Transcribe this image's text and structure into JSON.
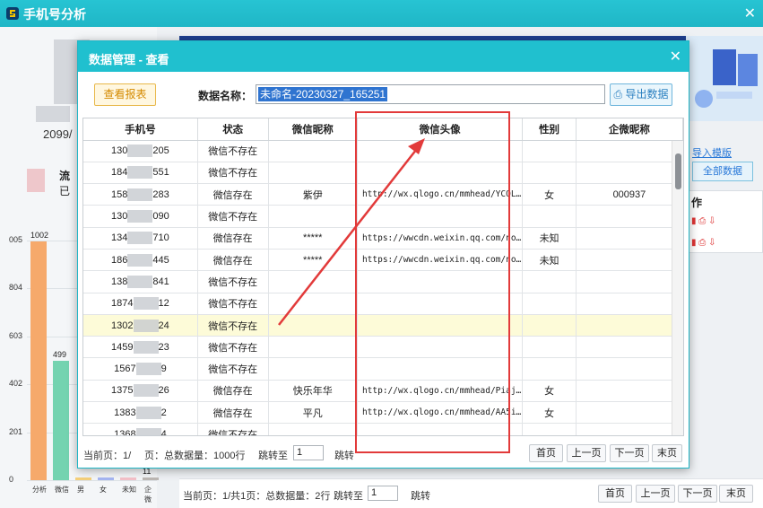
{
  "app": {
    "title": "手机号分析"
  },
  "left": {
    "year_text": "2099/",
    "flow_text": "流",
    "yi_text": "已",
    "chart_data": {
      "type": "bar",
      "categories": [
        "分析",
        "微信",
        "男",
        "女",
        "未知",
        "企微"
      ],
      "values": [
        1002,
        499,
        0,
        0,
        0,
        11
      ],
      "yticks": [
        "005",
        "804",
        "603",
        "402",
        "201",
        "0"
      ],
      "value_labels": [
        "1002",
        "499",
        "",
        "",
        "",
        "11"
      ]
    }
  },
  "background": {
    "import_link": "导入模版",
    "all_data_btn": "全部数据",
    "op_header": "作",
    "pagination": {
      "current": "当前页：1/共1页：总数据量：2行",
      "jump_label": "跳转至",
      "jump_value": "1",
      "jump_btn": "跳转",
      "first": "首页",
      "prev": "上一页",
      "next": "下一页",
      "last": "末页"
    }
  },
  "dialog": {
    "title": "数据管理 - 查看",
    "report_btn": "查看报表",
    "name_label": "数据名称：",
    "name_value": "未命名-20230327_165251",
    "export_btn": "导出数据",
    "columns": [
      "手机号",
      "状态",
      "微信昵称",
      "微信头像",
      "性别",
      "企微昵称"
    ],
    "rows": [
      {
        "p1": "130",
        "p2": "205",
        "status": "微信不存在",
        "nick": "",
        "avatar": "",
        "gender": "",
        "wwnick": ""
      },
      {
        "p1": "184",
        "p2": "551",
        "status": "微信不存在",
        "nick": "",
        "avatar": "",
        "gender": "",
        "wwnick": ""
      },
      {
        "p1": "158",
        "p2": "283",
        "status": "微信存在",
        "nick": "紫伊",
        "avatar": "http://wx.qlogo.cn/mmhead/YCOL…",
        "gender": "女",
        "wwnick": "000937"
      },
      {
        "p1": "130",
        "p2": "090",
        "status": "微信不存在",
        "nick": "",
        "avatar": "",
        "gender": "",
        "wwnick": ""
      },
      {
        "p1": "134",
        "p2": "710",
        "status": "微信存在",
        "nick": "*****",
        "avatar": "https://wwcdn.weixin.qq.com/no…",
        "gender": "未知",
        "wwnick": ""
      },
      {
        "p1": "186",
        "p2": "445",
        "status": "微信存在",
        "nick": "*****",
        "avatar": "https://wwcdn.weixin.qq.com/no…",
        "gender": "未知",
        "wwnick": ""
      },
      {
        "p1": "138",
        "p2": "841",
        "status": "微信不存在",
        "nick": "",
        "avatar": "",
        "gender": "",
        "wwnick": ""
      },
      {
        "p1": "1874",
        "p2": "12",
        "status": "微信不存在",
        "nick": "",
        "avatar": "",
        "gender": "",
        "wwnick": ""
      },
      {
        "p1": "1302",
        "p2": "24",
        "status": "微信不存在",
        "nick": "",
        "avatar": "",
        "gender": "",
        "wwnick": ""
      },
      {
        "p1": "1459",
        "p2": "23",
        "status": "微信不存在",
        "nick": "",
        "avatar": "",
        "gender": "",
        "wwnick": ""
      },
      {
        "p1": "1567",
        "p2": "9",
        "status": "微信不存在",
        "nick": "",
        "avatar": "",
        "gender": "",
        "wwnick": ""
      },
      {
        "p1": "1375",
        "p2": "26",
        "status": "微信存在",
        "nick": "快乐年华",
        "avatar": "http://wx.qlogo.cn/mmhead/Piaj…",
        "gender": "女",
        "wwnick": ""
      },
      {
        "p1": "1383",
        "p2": "2",
        "status": "微信存在",
        "nick": "平凡",
        "avatar": "http://wx.qlogo.cn/mmhead/AA5i…",
        "gender": "女",
        "wwnick": ""
      },
      {
        "p1": "1368",
        "p2": "4",
        "status": "微信不存在",
        "nick": "",
        "avatar": "",
        "gender": "",
        "wwnick": ""
      }
    ],
    "footer": {
      "current_a": "当前页：1/",
      "current_b": "页：总数据量：1000行",
      "jump_label": "跳转至",
      "jump_value": "1",
      "jump_btn": "跳转",
      "first": "首页",
      "prev": "上一页",
      "next": "下一页",
      "last": "末页"
    }
  },
  "colors": {
    "title_bar": "#1fb6c6",
    "highlight": "#e23a3a",
    "bar_colors": [
      "#f6a96b",
      "#74d3b0",
      "#f5d07a",
      "#a6b6f2",
      "#f4c1c9",
      "#bdb8b4"
    ]
  }
}
